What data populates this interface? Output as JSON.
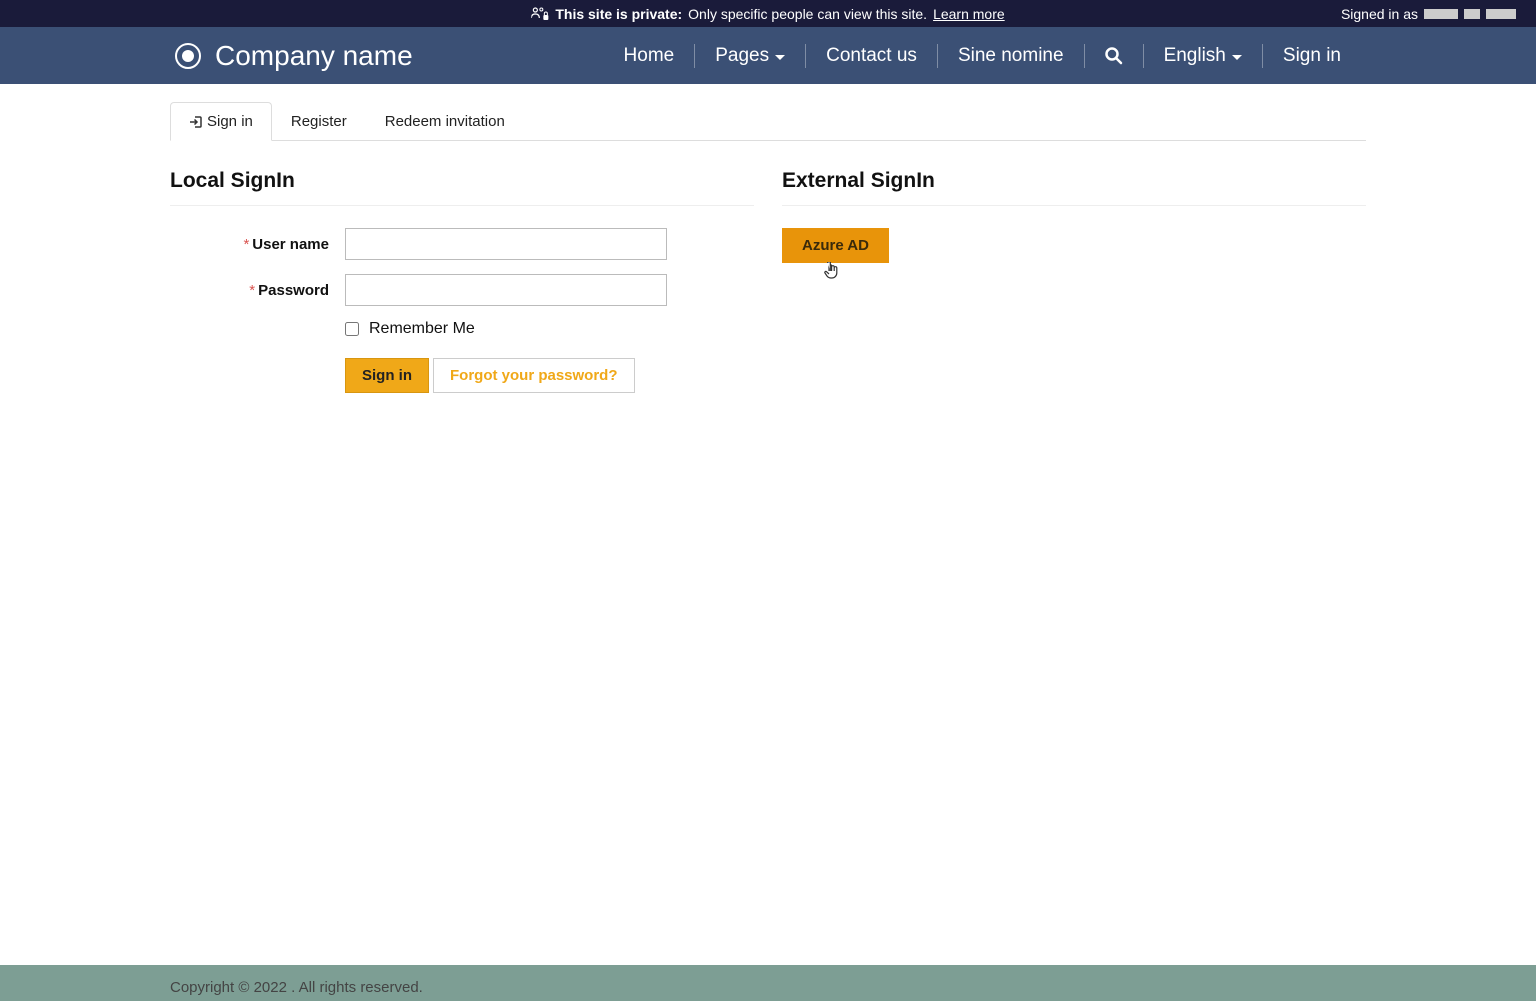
{
  "banner": {
    "private_label": "This site is private:",
    "private_desc": "Only specific people can view this site.",
    "learn_more": "Learn more",
    "signed_in_as": "Signed in as"
  },
  "navbar": {
    "brand": "Company name",
    "items": {
      "home": "Home",
      "pages": "Pages",
      "contact": "Contact us",
      "sine": "Sine nomine",
      "language": "English",
      "signin": "Sign in"
    }
  },
  "tabs": {
    "signin": "Sign in",
    "register": "Register",
    "redeem": "Redeem invitation"
  },
  "local": {
    "heading": "Local SignIn",
    "username_label": "User name",
    "password_label": "Password",
    "remember": "Remember Me",
    "signin_btn": "Sign in",
    "forgot_btn": "Forgot your password?"
  },
  "external": {
    "heading": "External SignIn",
    "azure_btn": "Azure AD"
  },
  "footer": {
    "copyright": "Copyright © 2022 . All rights reserved."
  }
}
